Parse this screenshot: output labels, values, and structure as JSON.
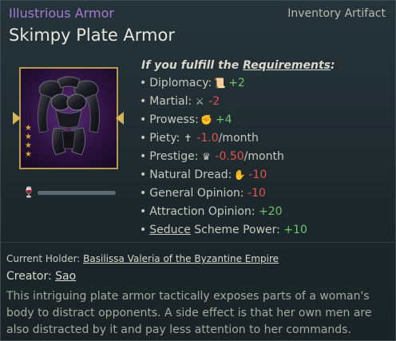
{
  "header": {
    "rarity": "Illustrious Armor",
    "category": "Inventory Artifact",
    "item_name": "Skimpy Plate Armor"
  },
  "artifact": {
    "stars": 4,
    "durability": 1.0
  },
  "requirements": {
    "prefix": "If you fulfill the ",
    "link": "Requirements",
    "suffix": ":"
  },
  "modifiers": [
    {
      "label": "Diplomacy:",
      "icon": "scroll-icon",
      "glyph": "📜",
      "value": "+2",
      "tone": "pos",
      "unit": ""
    },
    {
      "label": "Martial:",
      "icon": "crossed-swords-icon",
      "glyph": "⚔",
      "value": "-2",
      "tone": "neg",
      "unit": ""
    },
    {
      "label": "Prowess:",
      "icon": "fist-icon",
      "glyph": "✊",
      "value": "+4",
      "tone": "pos",
      "unit": ""
    },
    {
      "label": "Piety:",
      "icon": "praying-figure-icon",
      "glyph": "✝",
      "value": "-1.0",
      "tone": "neg",
      "unit": "/month"
    },
    {
      "label": "Prestige:",
      "icon": "crown-icon",
      "glyph": "♛",
      "value": "-0.50",
      "tone": "neg",
      "unit": "/month"
    },
    {
      "label": "Natural Dread:",
      "icon": "dread-claw-icon",
      "glyph": "✋",
      "value": "-10",
      "tone": "neg",
      "unit": ""
    },
    {
      "label": "General Opinion:",
      "icon": "",
      "glyph": "",
      "value": "-10",
      "tone": "neg",
      "unit": ""
    },
    {
      "label": "Attraction Opinion:",
      "icon": "",
      "glyph": "",
      "value": "+20",
      "tone": "pos",
      "unit": ""
    },
    {
      "label": "Scheme Power:",
      "label_link": "Seduce",
      "icon": "",
      "glyph": "",
      "value": "+10",
      "tone": "pos",
      "unit": ""
    }
  ],
  "holder": {
    "label": "Current Holder: ",
    "name": "Basilissa Valeria of the Byzantine Empire"
  },
  "creator": {
    "label": "Creator: ",
    "name": "Sao"
  },
  "description": "This intriguing plate armor tactically exposes parts of a woman's body to distract opponents. A side effect is that her own men are also distracted by it and pay less attention to her commands.",
  "colors": {
    "rarity": "#a57ad6",
    "positive": "#6ec56a",
    "negative": "#e0544e",
    "frame": "#b89a52"
  }
}
